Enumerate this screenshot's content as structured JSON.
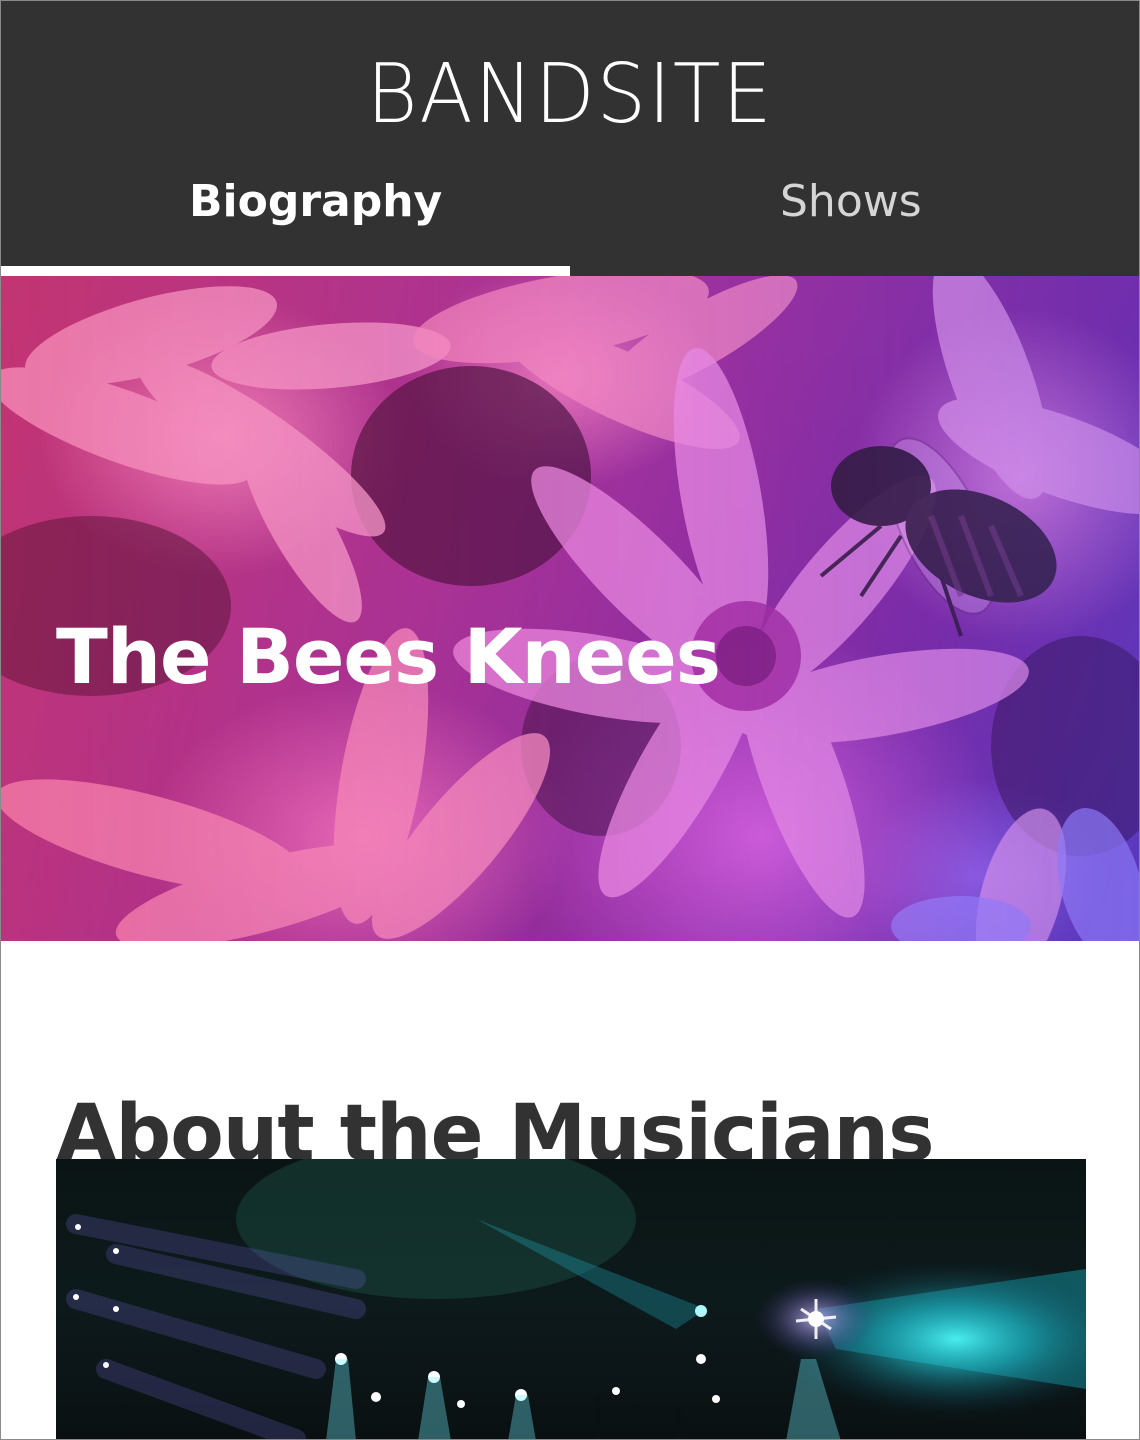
{
  "header": {
    "logo": "BANDSITE",
    "tabs": [
      {
        "label": "Biography",
        "active": true
      },
      {
        "label": "Shows",
        "active": false
      }
    ]
  },
  "hero": {
    "title": "The Bees Knees",
    "image": "pink-flowers-with-bee"
  },
  "about": {
    "title": "About the Musicians",
    "image": "concert-stage-lights"
  },
  "colors": {
    "header_bg": "#323232",
    "text_dark": "#323232",
    "white": "#ffffff"
  }
}
